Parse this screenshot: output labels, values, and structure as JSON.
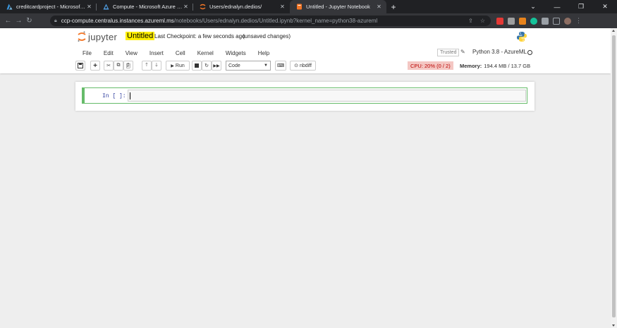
{
  "browser": {
    "tabs": [
      {
        "title": "creditcardproject - Microsoft Azu",
        "icon": "azure-icon",
        "color": "#3a96dd"
      },
      {
        "title": "Compute - Microsoft Azure Machi",
        "icon": "azureml-icon",
        "color": "#50a0e6"
      },
      {
        "title": "Users/ednalyn.dedios/",
        "icon": "jupyter-icon",
        "color": "#f37626"
      },
      {
        "title": "Untitled - Jupyter Notebook",
        "icon": "notebook-icon",
        "color": "#f37626",
        "active": true
      }
    ],
    "url_host": "ccp-compute.centralus.instances.azureml.ms",
    "url_path": "/notebooks/Users/ednalyn.dedios/Untitled.ipynb?kernel_name=python38-azureml"
  },
  "jupyter": {
    "logo_text": "jupyter",
    "notebook_title": "Untitled",
    "checkpoint": "Last Checkpoint: a few seconds ago",
    "unsaved": "(unsaved changes)",
    "menu": [
      "File",
      "Edit",
      "View",
      "Insert",
      "Cell",
      "Kernel",
      "Widgets",
      "Help"
    ],
    "trusted": "Trusted",
    "kernel_name": "Python 3.8 - AzureML",
    "toolbar": {
      "run_label": "Run",
      "cell_type": "Code",
      "nbdiff_label": "nbdiff"
    },
    "cpu": "CPU: 20% (0 / 2)",
    "memory_label": "Memory:",
    "memory_value": "194.4 MB / 13.7 GB",
    "cell_prompt": "In [ ]:"
  }
}
